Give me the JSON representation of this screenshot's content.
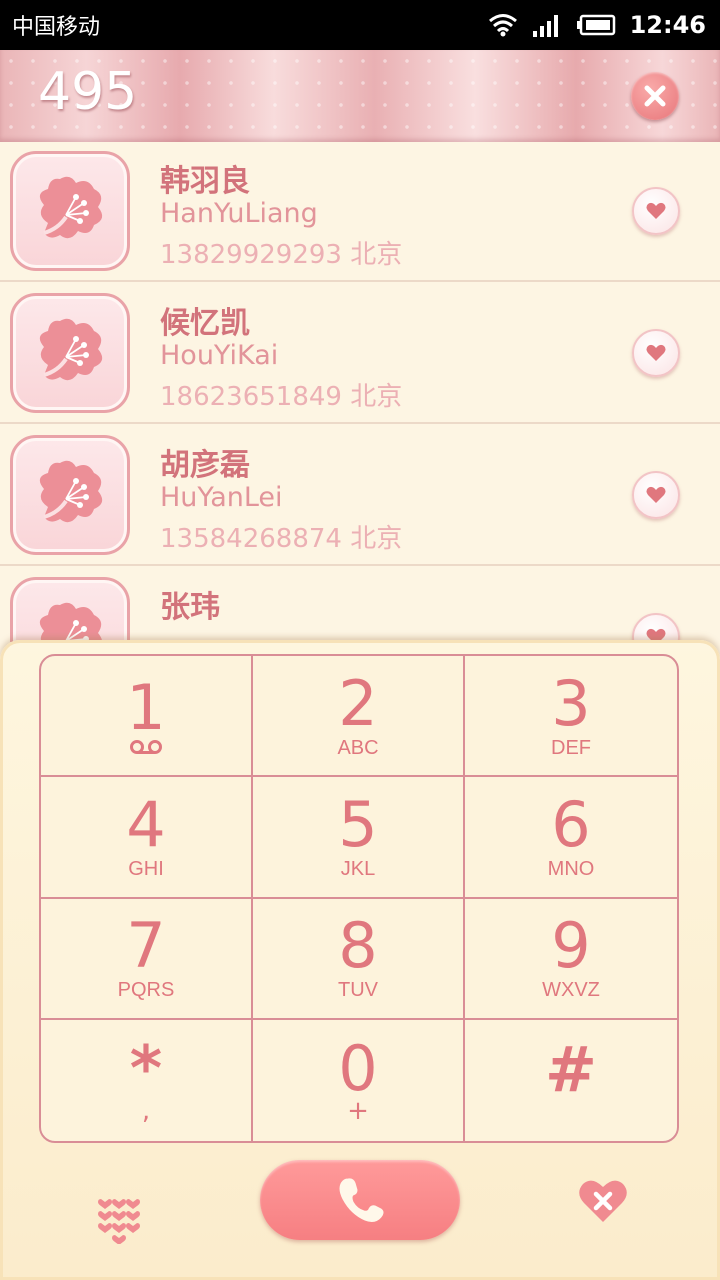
{
  "status_bar": {
    "carrier": "中国移动",
    "time": "12:46",
    "icons": [
      "wifi-icon",
      "signal-icon",
      "battery-icon"
    ]
  },
  "search": {
    "query": "495",
    "clear_icon": "close-icon"
  },
  "contacts": [
    {
      "name": "韩羽良",
      "pinyin": "HanYuLiang",
      "number": "13829929293",
      "location": "北京"
    },
    {
      "name": "候忆凯",
      "pinyin": "HouYiKai",
      "number": "18623651849",
      "location": "北京"
    },
    {
      "name": "胡彦磊",
      "pinyin": "HuYanLei",
      "number": "13584268874",
      "location": "北京"
    },
    {
      "name": "张玮",
      "pinyin": "",
      "number": "",
      "location": ""
    }
  ],
  "keypad": [
    {
      "digit": "1",
      "letters": "",
      "icon": "voicemail-icon"
    },
    {
      "digit": "2",
      "letters": "ABC"
    },
    {
      "digit": "3",
      "letters": "DEF"
    },
    {
      "digit": "4",
      "letters": "GHI"
    },
    {
      "digit": "5",
      "letters": "JKL"
    },
    {
      "digit": "6",
      "letters": "MNO"
    },
    {
      "digit": "7",
      "letters": "PQRS"
    },
    {
      "digit": "8",
      "letters": "TUV"
    },
    {
      "digit": "9",
      "letters": "WXVZ"
    },
    {
      "digit": "*",
      "letters": ","
    },
    {
      "digit": "0",
      "letters": "+"
    },
    {
      "digit": "#",
      "letters": ""
    }
  ],
  "actions": {
    "left_icon": "keypad-toggle-icon",
    "call_icon": "phone-icon",
    "right_icon": "heart-delete-icon"
  },
  "colors": {
    "accent": "#e0777e",
    "background": "#fdf5e3",
    "call_button": "#f67f82"
  }
}
